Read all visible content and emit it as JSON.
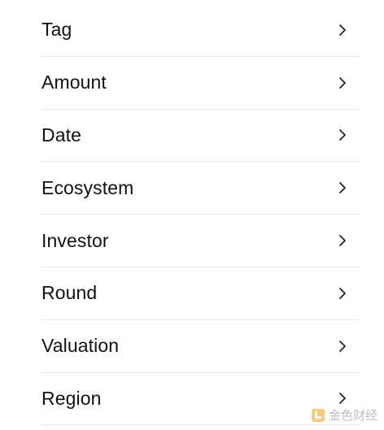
{
  "filters": {
    "items": [
      {
        "label": "Tag"
      },
      {
        "label": "Amount"
      },
      {
        "label": "Date"
      },
      {
        "label": "Ecosystem"
      },
      {
        "label": "Investor"
      },
      {
        "label": "Round"
      },
      {
        "label": "Valuation"
      },
      {
        "label": "Region"
      }
    ],
    "chevron_icon": "chevron-right-icon"
  },
  "watermark": {
    "text": "金色财经",
    "logo_icon": "jinse-logo-icon",
    "logo_color": "#e8a317"
  }
}
